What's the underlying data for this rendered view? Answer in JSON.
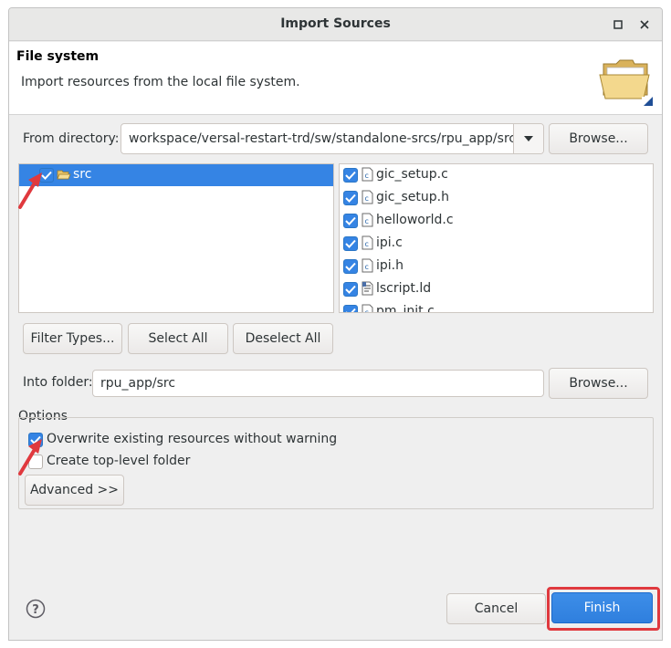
{
  "window": {
    "title": "Import Sources"
  },
  "header": {
    "title": "File system",
    "description": "Import resources from the local file system.",
    "icon": "folder-icon"
  },
  "from_directory": {
    "label": "From directory:",
    "value": "workspace/versal-restart-trd/sw/standalone-srcs/rpu_app/src",
    "browse_label": "Browse..."
  },
  "tree": {
    "items": [
      {
        "label": "src",
        "checked": true,
        "selected": true
      }
    ]
  },
  "files": [
    {
      "name": "gic_setup.c",
      "checked": true,
      "icon": "c-source-file-icon"
    },
    {
      "name": "gic_setup.h",
      "checked": true,
      "icon": "c-header-file-icon"
    },
    {
      "name": "helloworld.c",
      "checked": true,
      "icon": "c-source-file-icon"
    },
    {
      "name": "ipi.c",
      "checked": true,
      "icon": "c-source-file-icon"
    },
    {
      "name": "ipi.h",
      "checked": true,
      "icon": "c-header-file-icon"
    },
    {
      "name": "lscript.ld",
      "checked": true,
      "icon": "linker-script-file-icon"
    },
    {
      "name": "pm_init.c",
      "checked": true,
      "icon": "c-source-file-icon"
    }
  ],
  "selection_buttons": {
    "filter_types": "Filter Types...",
    "select_all": "Select All",
    "deselect_all": "Deselect All"
  },
  "into_folder": {
    "label": "Into folder:",
    "value": "rpu_app/src",
    "browse_label": "Browse..."
  },
  "options": {
    "title": "Options",
    "overwrite_label": "Overwrite existing resources without warning",
    "overwrite_checked": true,
    "top_level_label": "Create top-level folder",
    "top_level_checked": false,
    "advanced_label": "Advanced >>"
  },
  "footer": {
    "help_icon": "help-icon",
    "cancel_label": "Cancel",
    "finish_label": "Finish"
  },
  "colors": {
    "accent": "#3584e4",
    "annotation": "#e0393e"
  }
}
